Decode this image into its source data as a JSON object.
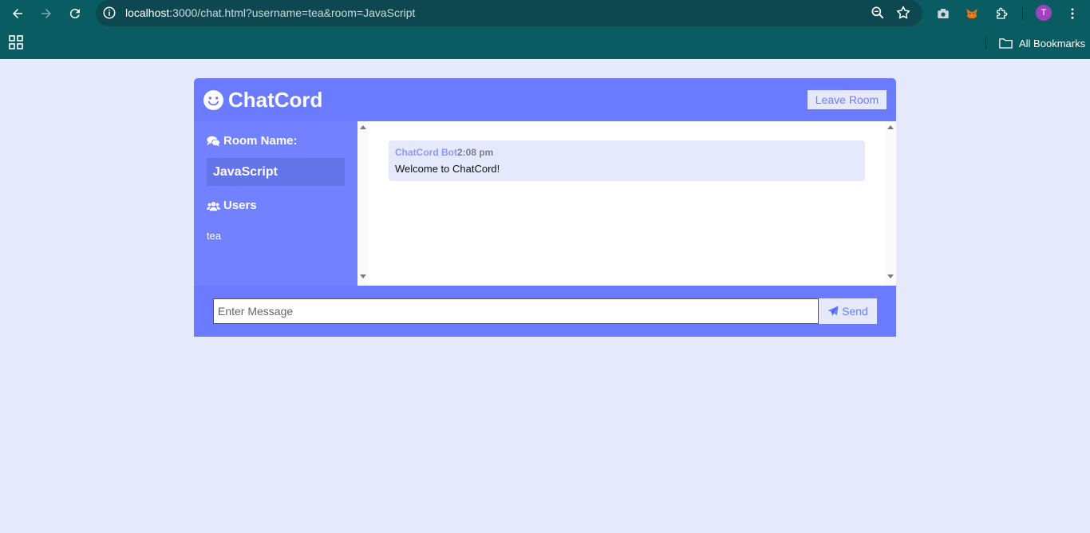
{
  "browser": {
    "url_host": "localhost",
    "url_rest": ":3000/chat.html?username=tea&room=JavaScript",
    "profile_initial": "T",
    "all_bookmarks": "All Bookmarks"
  },
  "app": {
    "brand": "ChatCord",
    "leave_label": "Leave Room",
    "room_heading": "Room Name:",
    "room_name": "JavaScript",
    "users_heading": "Users",
    "users": [
      "tea"
    ]
  },
  "messages": [
    {
      "sender": "ChatCord Bot",
      "time": "2:08 pm",
      "text": "Welcome to ChatCord!"
    }
  ],
  "composer": {
    "placeholder": "Enter Message",
    "send_label": "Send"
  },
  "colors": {
    "primary": "#6b7bff",
    "light": "#e6e9fc",
    "chrome": "#0a5c63"
  }
}
